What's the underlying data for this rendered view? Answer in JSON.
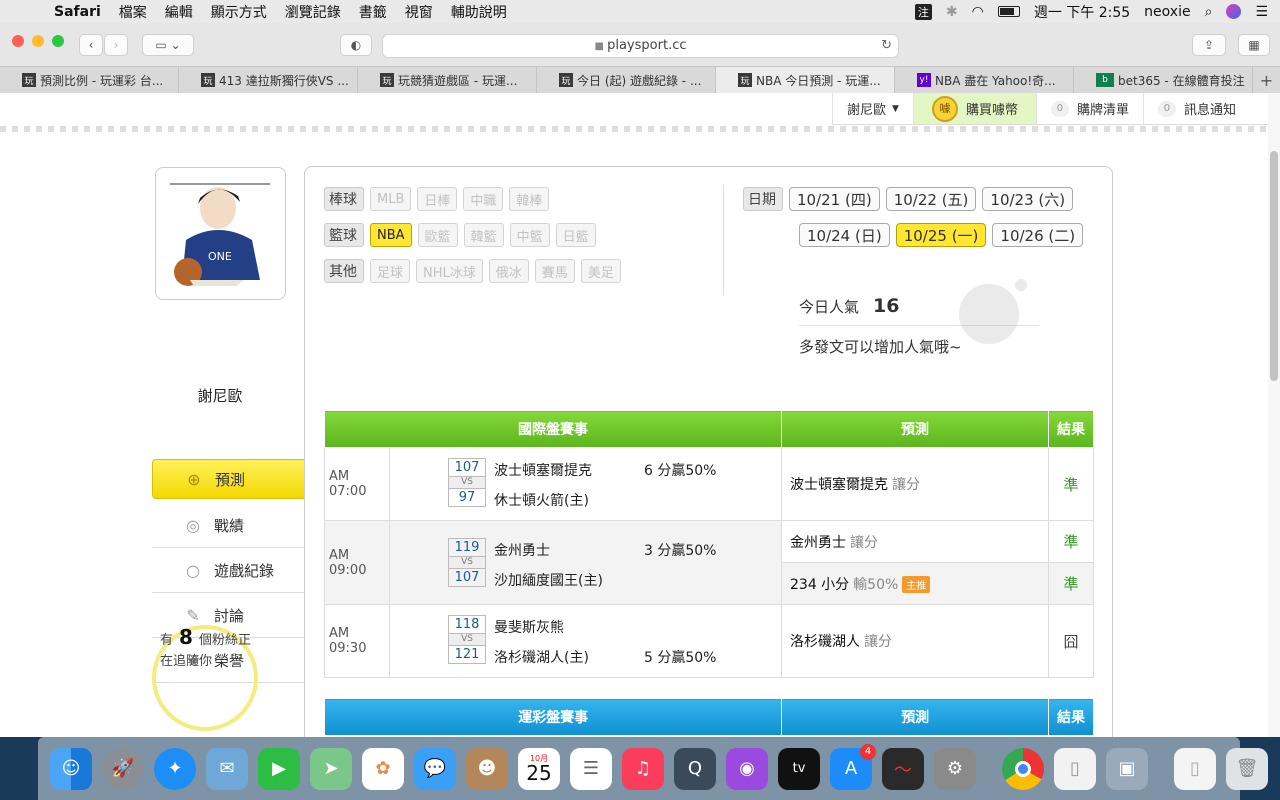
{
  "menubar": {
    "app": "Safari",
    "items": [
      "檔案",
      "編輯",
      "顯示方式",
      "瀏覽記錄",
      "書籤",
      "視窗",
      "輔助說明"
    ],
    "input_indicator": "注",
    "datetime": "週一 下午 2:55",
    "user": "neoxie"
  },
  "browser": {
    "url": "playsport.cc",
    "tabs": [
      "預測比例 - 玩運彩 台...",
      "413 達拉斯獨行俠VS ...",
      "玩競猜遊戲區 - 玩運...",
      "今日 (起) 遊戲紀錄 - ...",
      "NBA 今日預測 - 玩運...",
      "NBA 盡在 Yahoo!奇...",
      "bet365 - 在線體育投注"
    ]
  },
  "topnav": {
    "user": "謝尼歐",
    "buy": "購買噱幣",
    "cart_count": "0",
    "cart": "購牌清單",
    "msg_count": "0",
    "msg": "訊息通知"
  },
  "sidebar": {
    "name": "謝尼歐",
    "menu": [
      "預測",
      "戰績",
      "遊戲紀錄",
      "討論",
      "榮譽"
    ],
    "fans_pre": "有",
    "fans_num": "8",
    "fans_post": "個粉絲正",
    "fans_line2": "在追隨你"
  },
  "filters": {
    "baseball": {
      "label": "棒球",
      "chips": [
        "MLB",
        "日棒",
        "中職",
        "韓棒"
      ]
    },
    "basketball": {
      "label": "籃球",
      "chips": [
        "NBA",
        "歐籃",
        "韓籃",
        "中籃",
        "日籃"
      ]
    },
    "other": {
      "label": "其他",
      "chips": [
        "足球",
        "NHL冰球",
        "俄冰",
        "賽馬",
        "美足"
      ]
    },
    "date_label": "日期",
    "dates": [
      "10/21 (四)",
      "10/22 (五)",
      "10/23 (六)",
      "10/24 (日)",
      "10/25 (一)",
      "10/26 (二)"
    ]
  },
  "popularity": {
    "label": "今日人氣",
    "value": "16",
    "hint": "多發文可以增加人氣哦~"
  },
  "table1": {
    "h1": "國際盤賽事",
    "h2": "預測",
    "h3": "結果",
    "rows": [
      {
        "time": "AM 07:00",
        "s1": "107",
        "t1": "波士頓塞爾提克",
        "s2": "97",
        "t2": "休士頓火箭(主)",
        "line": "6 分贏50%",
        "pick": "波士頓塞爾提克",
        "pick_sub": "讓分",
        "result": "準"
      },
      {
        "time": "AM 09:00",
        "s1": "119",
        "t1": "金州勇士",
        "s2": "107",
        "t2": "沙加緬度國王(主)",
        "line": "3 分贏50%",
        "pick": "金州勇士",
        "pick_sub": "讓分",
        "result": "準",
        "pick2": "234 小分",
        "pick2_sub": "輸50%",
        "badge": "主推",
        "result2": "準"
      },
      {
        "time": "AM 09:30",
        "s1": "118",
        "t1": "曼斐斯灰熊",
        "s2": "121",
        "t2": "洛杉磯湖人(主)",
        "line": "5 分贏50%",
        "pick": "洛杉磯湖人",
        "pick_sub": "讓分",
        "result": "囧"
      }
    ]
  },
  "table2": {
    "h1": "運彩盤賽事",
    "h2": "預測",
    "h3": "結果"
  },
  "dock": {
    "calendar_month": "10月",
    "calendar_day": "25",
    "appstore_badge": "4"
  }
}
